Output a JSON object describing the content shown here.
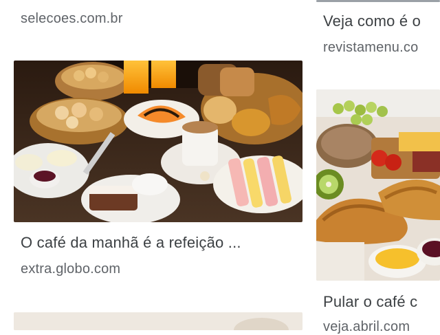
{
  "results": [
    {
      "id": "selecoes",
      "title": "",
      "source": "selecoes.com.br"
    },
    {
      "id": "revistamenu",
      "title": "Veja como é o",
      "source": "revistamenu.co"
    },
    {
      "id": "extra",
      "title": "O café da manhã é a refeição ...",
      "source": "extra.globo.com",
      "image": "breakfast-table-photo"
    },
    {
      "id": "veja",
      "title": "Pular o café c",
      "source": "veja.abril.com",
      "image": "croissant-fruit-breakfast-photo"
    },
    {
      "id": "next",
      "image": "breakfast-photo-partial"
    }
  ]
}
